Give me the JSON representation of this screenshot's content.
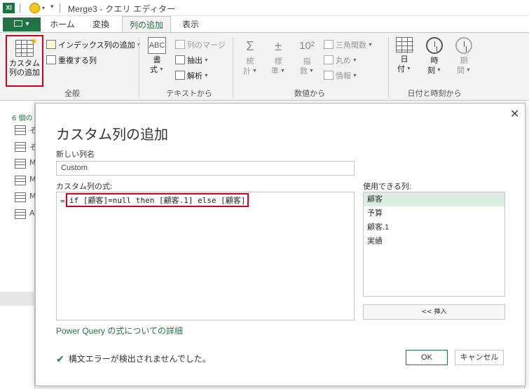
{
  "window": {
    "title": "Merge3 - クエリ エディター",
    "app_icon": "XI"
  },
  "tabs": {
    "file": "",
    "items": [
      "ホーム",
      "変換",
      "列の追加",
      "表示"
    ],
    "active": "列の追加"
  },
  "ribbon": {
    "general": {
      "custom_column_line1": "カスタム",
      "custom_column_line2": "列の追加",
      "add_index": "インデックス列の追加",
      "duplicate": "重複する列",
      "group_label": "全般"
    },
    "text": {
      "format_line1": "書",
      "format_line2": "式",
      "merge": "列のマージ",
      "extract": "抽出",
      "parse": "解析",
      "group_label": "テキストから"
    },
    "number": {
      "stats_line1": "統",
      "stats_line2": "計",
      "standard_line1": "標",
      "standard_line2": "準",
      "scientific_line1": "指",
      "scientific_line2": "数",
      "trig": "三角関数",
      "round": "丸め",
      "info": "情報",
      "group_label": "数値から"
    },
    "datetime": {
      "date_line1": "日",
      "date_line2": "付",
      "time_line1": "時",
      "time_line2": "刻",
      "duration_line1": "期",
      "duration_line2": "間",
      "group_label": "日付と時刻から"
    }
  },
  "left_pane": {
    "count_label": "6 個の",
    "items": [
      "そ",
      "そ",
      "M",
      "M",
      "M",
      "A"
    ]
  },
  "dialog": {
    "title": "カスタム列の追加",
    "new_column_label": "新しい列名",
    "new_column_value": "Custom",
    "formula_label": "カスタム列の式:",
    "formula_prefix": "=",
    "formula_text": "if [顧客]=null then [顧客.1] else [顧客]",
    "available_label": "使用できる列:",
    "available_columns": [
      "顧客",
      "予算",
      "顧客.1",
      "実績"
    ],
    "selected_column": "顧客",
    "insert_button": "<< 挿入",
    "help_link": "Power Query の式についての詳細",
    "status": "構文エラーが検出されませんでした。",
    "ok": "OK",
    "cancel": "キャンセル"
  },
  "colors": {
    "accent": "#217346",
    "highlight": "#d0021b"
  }
}
